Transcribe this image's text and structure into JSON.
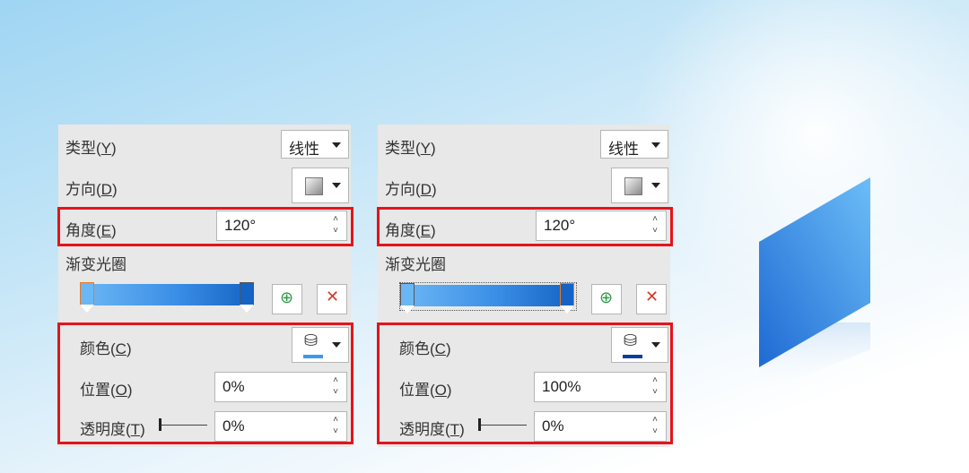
{
  "panels": [
    {
      "type_label": "类型",
      "type_key": "Y",
      "type_value": "线性",
      "direction_label": "方向",
      "direction_key": "D",
      "angle_label": "角度",
      "angle_key": "E",
      "angle_value": "120°",
      "stops_label": "渐变光圈",
      "color_label": "颜色",
      "color_key": "C",
      "color_underline": "#3b9af0",
      "position_label": "位置",
      "position_key": "O",
      "position_value": "0%",
      "transparency_label": "透明度",
      "transparency_key": "T",
      "transparency_value": "0%",
      "selected_stop": "left"
    },
    {
      "type_label": "类型",
      "type_key": "Y",
      "type_value": "线性",
      "direction_label": "方向",
      "direction_key": "D",
      "angle_label": "角度",
      "angle_key": "E",
      "angle_value": "120°",
      "stops_label": "渐变光圈",
      "color_label": "颜色",
      "color_key": "C",
      "color_underline": "#0a3f9e",
      "position_label": "位置",
      "position_key": "O",
      "position_value": "100%",
      "transparency_label": "透明度",
      "transparency_key": "T",
      "transparency_value": "0%",
      "selected_stop": "right"
    }
  ],
  "colors": {
    "highlight": "#e3141b",
    "gradient_start": "#6bb6f5",
    "gradient_end": "#1563c4",
    "stop_selected_border": "#e87b25"
  }
}
